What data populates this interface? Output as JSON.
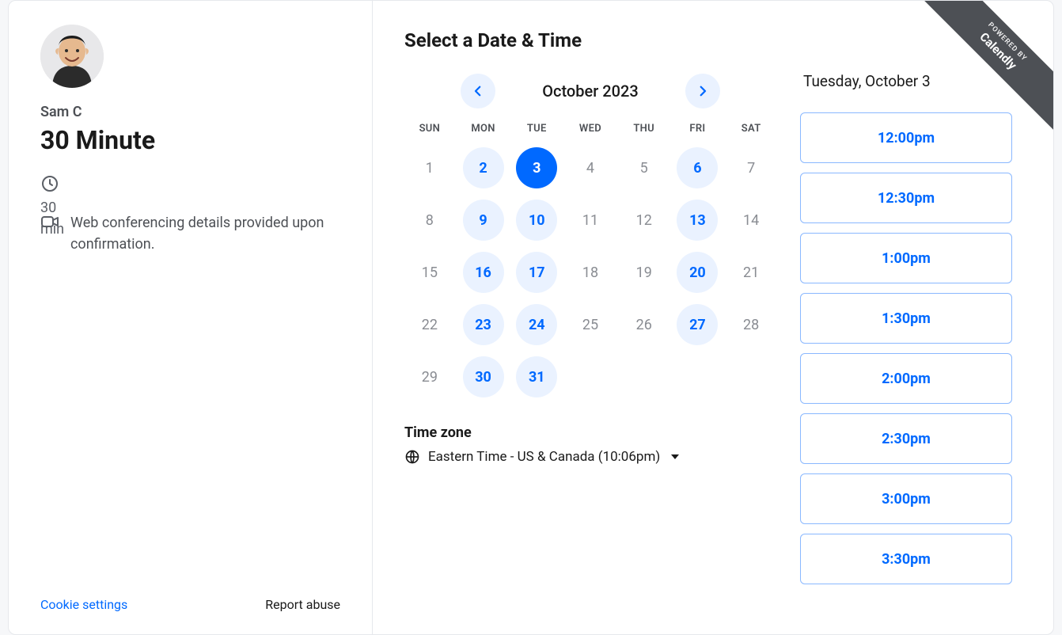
{
  "ribbon": {
    "powered_by": "POWERED BY",
    "brand": "Calendly"
  },
  "host": {
    "name": "Sam C",
    "event_title": "30 Minute"
  },
  "meta": {
    "duration": "30 min",
    "location": "Web conferencing details provided upon confirmation."
  },
  "footer": {
    "cookie_settings": "Cookie settings",
    "report_abuse": "Report abuse"
  },
  "page_title": "Select a Date & Time",
  "calendar": {
    "month_label": "October 2023",
    "weekdays": [
      "SUN",
      "MON",
      "TUE",
      "WED",
      "THU",
      "FRI",
      "SAT"
    ],
    "days": [
      {
        "n": "1",
        "state": "unavailable"
      },
      {
        "n": "2",
        "state": "available"
      },
      {
        "n": "3",
        "state": "selected"
      },
      {
        "n": "4",
        "state": "unavailable"
      },
      {
        "n": "5",
        "state": "unavailable"
      },
      {
        "n": "6",
        "state": "available"
      },
      {
        "n": "7",
        "state": "unavailable"
      },
      {
        "n": "8",
        "state": "unavailable"
      },
      {
        "n": "9",
        "state": "available"
      },
      {
        "n": "10",
        "state": "available"
      },
      {
        "n": "11",
        "state": "unavailable"
      },
      {
        "n": "12",
        "state": "unavailable"
      },
      {
        "n": "13",
        "state": "available"
      },
      {
        "n": "14",
        "state": "unavailable"
      },
      {
        "n": "15",
        "state": "unavailable"
      },
      {
        "n": "16",
        "state": "available"
      },
      {
        "n": "17",
        "state": "available"
      },
      {
        "n": "18",
        "state": "unavailable"
      },
      {
        "n": "19",
        "state": "unavailable"
      },
      {
        "n": "20",
        "state": "available"
      },
      {
        "n": "21",
        "state": "unavailable"
      },
      {
        "n": "22",
        "state": "unavailable"
      },
      {
        "n": "23",
        "state": "available"
      },
      {
        "n": "24",
        "state": "available"
      },
      {
        "n": "25",
        "state": "unavailable"
      },
      {
        "n": "26",
        "state": "unavailable"
      },
      {
        "n": "27",
        "state": "available"
      },
      {
        "n": "28",
        "state": "unavailable"
      },
      {
        "n": "29",
        "state": "unavailable"
      },
      {
        "n": "30",
        "state": "available"
      },
      {
        "n": "31",
        "state": "available"
      }
    ]
  },
  "timezone": {
    "label": "Time zone",
    "value": "Eastern Time - US & Canada (10:06pm)"
  },
  "slots": {
    "heading": "Tuesday, October 3",
    "times": [
      "12:00pm",
      "12:30pm",
      "1:00pm",
      "1:30pm",
      "2:00pm",
      "2:30pm",
      "3:00pm",
      "3:30pm"
    ]
  }
}
